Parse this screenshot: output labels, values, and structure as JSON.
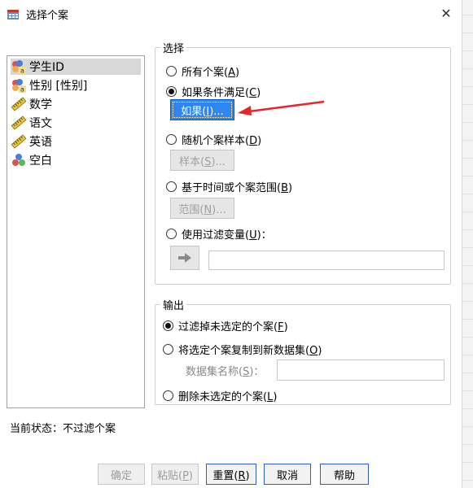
{
  "window": {
    "title": "选择个案",
    "close_glyph": "✕"
  },
  "variables": [
    {
      "label": "学生ID",
      "icon": "nominal-abc-icon",
      "selected": true
    },
    {
      "label": "性别 [性别]",
      "icon": "nominal-abc-icon",
      "selected": false
    },
    {
      "label": "数学",
      "icon": "scale-ruler-icon",
      "selected": false
    },
    {
      "label": "语文",
      "icon": "scale-ruler-icon",
      "selected": false
    },
    {
      "label": "英语",
      "icon": "scale-ruler-icon",
      "selected": false
    },
    {
      "label": "空白",
      "icon": "nominal-balls-icon",
      "selected": false
    }
  ],
  "select_group": {
    "title": "选择",
    "options": [
      {
        "label": "所有个案",
        "mnemonic": "A",
        "checked": false
      },
      {
        "label": "如果条件满足",
        "mnemonic": "C",
        "checked": true
      },
      {
        "label": "随机个案样本",
        "mnemonic": "D",
        "checked": false
      },
      {
        "label": "基于时间或个案范围",
        "mnemonic": "B",
        "checked": false
      },
      {
        "label": "使用过滤变量",
        "mnemonic": "U",
        "checked": false,
        "suffix": "："
      }
    ],
    "if_button": {
      "label": "如果",
      "mnemonic": "I",
      "suffix": "..."
    },
    "sample_button": {
      "label": "样本",
      "mnemonic": "S",
      "suffix": "..."
    },
    "range_button": {
      "label": "范围",
      "mnemonic": "N",
      "suffix": "..."
    },
    "move_arrow_icon": "arrow-right-icon",
    "filter_variable_value": ""
  },
  "output_group": {
    "title": "输出",
    "options": [
      {
        "label": "过滤掉未选定的个案",
        "mnemonic": "F",
        "checked": true
      },
      {
        "label": "将选定个案复制到新数据集",
        "mnemonic": "O",
        "checked": false
      },
      {
        "label": "删除未选定的个案",
        "mnemonic": "L",
        "checked": false
      }
    ],
    "dataset_name_label": "数据集名称",
    "dataset_name_mnemonic": "S",
    "dataset_name_value": ""
  },
  "status": {
    "text": "当前状态：不过滤个案"
  },
  "buttons": {
    "ok": {
      "label": "确定"
    },
    "paste": {
      "label": "粘贴",
      "mnemonic": "P"
    },
    "reset": {
      "label": "重置",
      "mnemonic": "R"
    },
    "cancel": {
      "label": "取消"
    },
    "help": {
      "label": "帮助"
    }
  },
  "colors": {
    "accent": "#2f86f0",
    "annotation_arrow": "#e8242a"
  }
}
